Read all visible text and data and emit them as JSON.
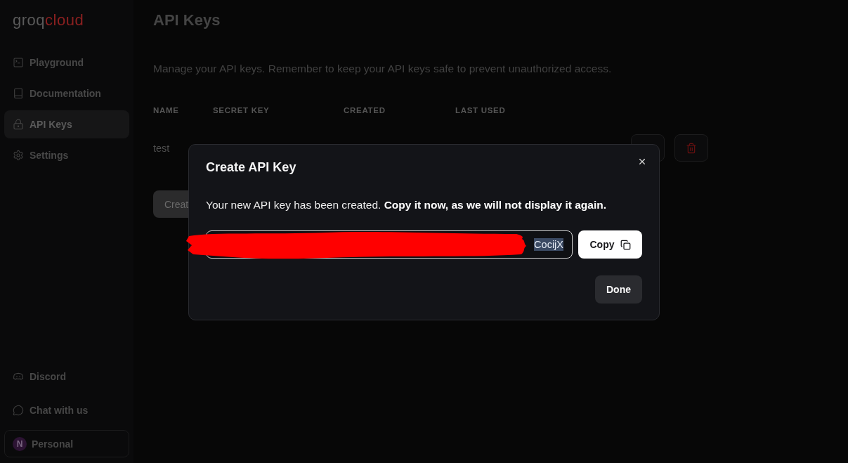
{
  "sidebar": {
    "logo": {
      "part_1": "groq",
      "part_2": "cloud"
    },
    "nav": [
      {
        "label": "Playground",
        "selected": false
      },
      {
        "label": "Documentation",
        "selected": false
      },
      {
        "label": "API Keys",
        "selected": true
      },
      {
        "label": "Settings",
        "selected": false
      }
    ],
    "footer_links": [
      {
        "label": "Discord"
      },
      {
        "label": "Chat with us"
      }
    ],
    "workspace": {
      "avatar_letter": "N",
      "label": "Personal"
    }
  },
  "page": {
    "title": "API Keys",
    "description": "Manage your API keys. Remember to keep your API keys safe to prevent unauthorized access.",
    "table": {
      "columns": [
        "NAME",
        "SECRET KEY",
        "CREATED",
        "LAST USED"
      ],
      "rows": [
        {
          "name": "test",
          "actions": [
            {
              "kind": "plain"
            },
            {
              "kind": "delete"
            }
          ]
        }
      ]
    },
    "create_button": "Creat"
  },
  "dialog": {
    "title": "Create API Key",
    "message": "Your new API key has been created. **Copy it now, as we will not display it again.**",
    "key_field": {
      "value": "CocijX",
      "highlighted": true,
      "redacted": true
    },
    "copy_button": "Copy",
    "done_button": "Done"
  }
}
